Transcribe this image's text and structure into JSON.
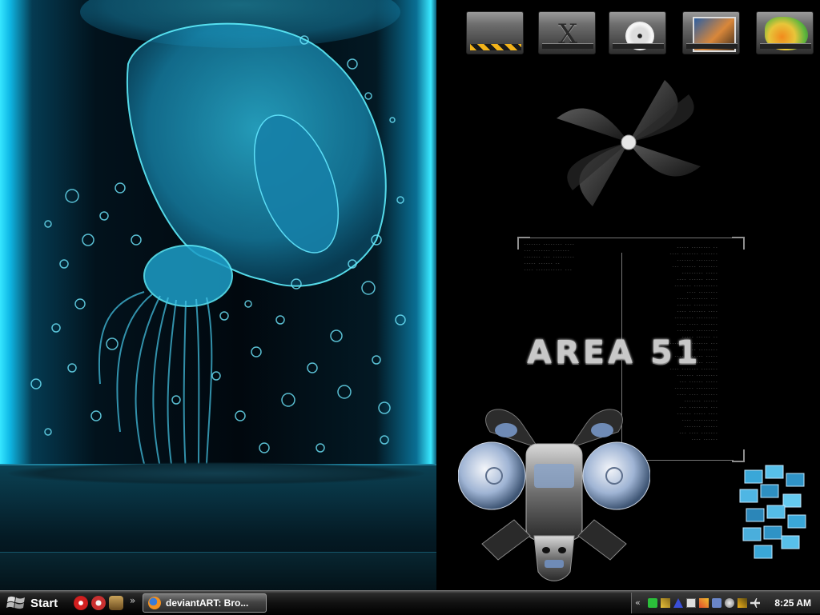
{
  "desktop": {
    "wallpaper_text": "AREA 51",
    "icons": [
      {
        "name": "hazard-drive-icon"
      },
      {
        "name": "x-drive-icon"
      },
      {
        "name": "cd-drive-icon"
      },
      {
        "name": "pictures-drive-icon"
      },
      {
        "name": "fish-drive-icon"
      }
    ]
  },
  "taskbar": {
    "start_label": "Start",
    "quicklaunch_chevron": "»",
    "tasks": [
      {
        "label": "deviantART: Bro..."
      }
    ],
    "tray_chevron": "«",
    "clock": "8:25 AM"
  },
  "colors": {
    "tube_cyan": "#36e6ff",
    "taskbar": "#111111",
    "hazard_yellow": "#f2b31a"
  }
}
